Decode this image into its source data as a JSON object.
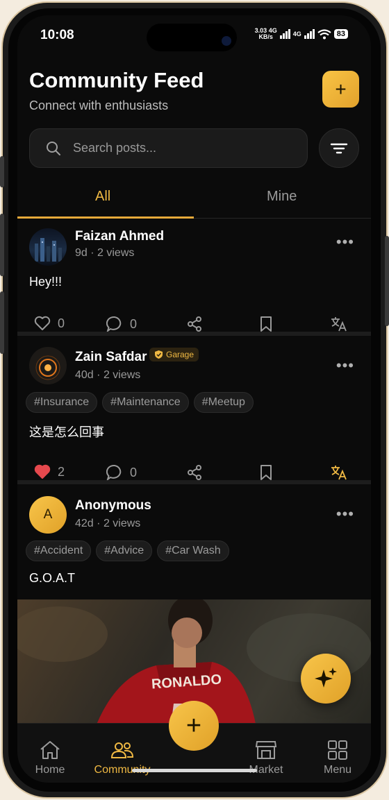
{
  "status": {
    "time": "10:08",
    "net_speed": "3.03",
    "net_unit": "KB/s",
    "net1": "4G",
    "net2": "4G",
    "battery": "83"
  },
  "header": {
    "title": "Community Feed",
    "subtitle": "Connect with enthusiasts",
    "add_label": "+"
  },
  "search": {
    "placeholder": "Search posts..."
  },
  "tabs": [
    {
      "label": "All",
      "active": true
    },
    {
      "label": "Mine",
      "active": false
    }
  ],
  "posts": [
    {
      "author": "Faizan Ahmed",
      "age": "9d",
      "views": "2 views",
      "text": "Hey!!!",
      "likes": "0",
      "comments": "0",
      "liked": false
    },
    {
      "author": "Zain Safdar",
      "badge": "Garage",
      "age": "40d",
      "views": "2 views",
      "tags": [
        "#Insurance",
        "#Maintenance",
        "#Meetup"
      ],
      "text": "这是怎么回事",
      "likes": "2",
      "comments": "0",
      "liked": true
    },
    {
      "author": "Anonymous",
      "avatar_letter": "A",
      "age": "42d",
      "views": "2 views",
      "tags": [
        "#Accident",
        "#Advice",
        "#Car Wash"
      ],
      "text": "G.O.A.T",
      "jersey": "RONALDO"
    }
  ],
  "meta_sep": "·",
  "more": "•••",
  "nav": [
    {
      "label": "Home",
      "icon": "home-icon"
    },
    {
      "label": "Community",
      "icon": "community-icon",
      "active": true
    },
    {
      "label": "Market",
      "icon": "store-icon"
    },
    {
      "label": "Menu",
      "icon": "grid-icon"
    }
  ],
  "fab_label": "+",
  "colors": {
    "accent": "#f0b943",
    "background": "#0b0b0b",
    "like": "#e5484d"
  }
}
